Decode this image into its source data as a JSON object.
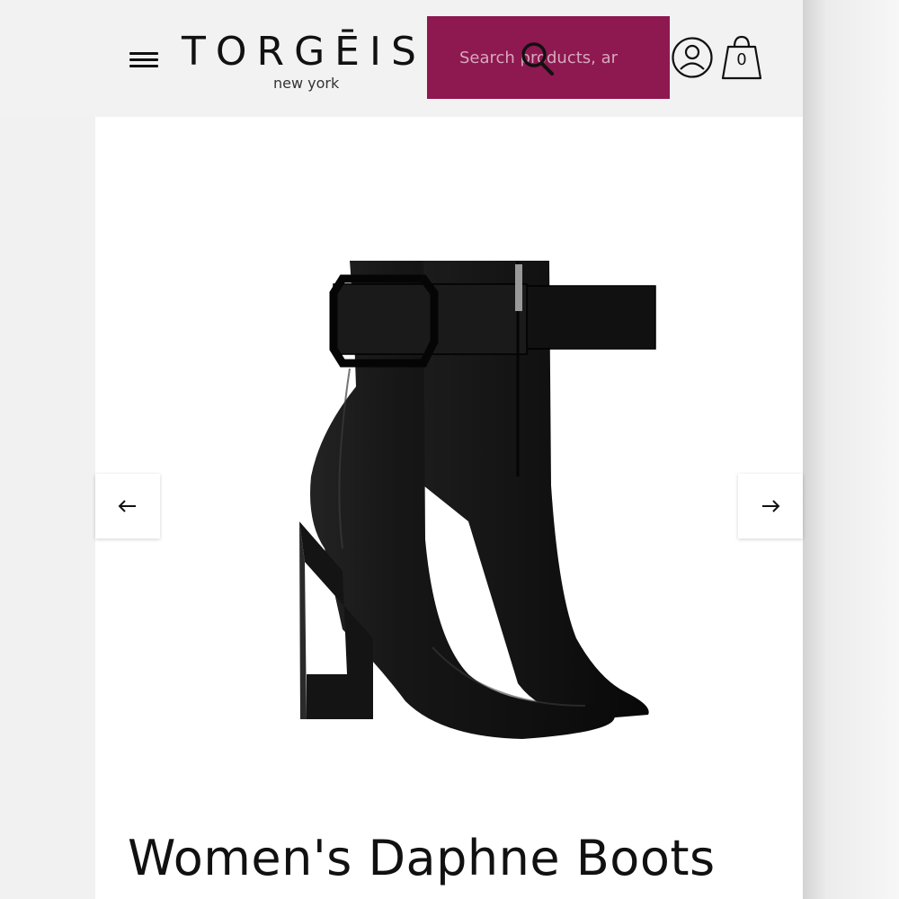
{
  "header": {
    "logo_text": "TORGĒIS",
    "logo_subtitle": "new york",
    "search_placeholder": "Search products, ar",
    "cart_count": "0",
    "icons": {
      "menu": "hamburger-menu-icon",
      "search": "search-icon",
      "account": "user-account-icon",
      "cart": "shopping-bag-icon"
    },
    "colors": {
      "search_bg": "#8e1850",
      "text": "#111111"
    }
  },
  "product": {
    "title": "Women's Daphne Boots",
    "image_alt": "black-leather-ankle-boots",
    "carousel": {
      "prev_icon": "arrow-left-icon",
      "next_icon": "arrow-right-icon"
    }
  }
}
